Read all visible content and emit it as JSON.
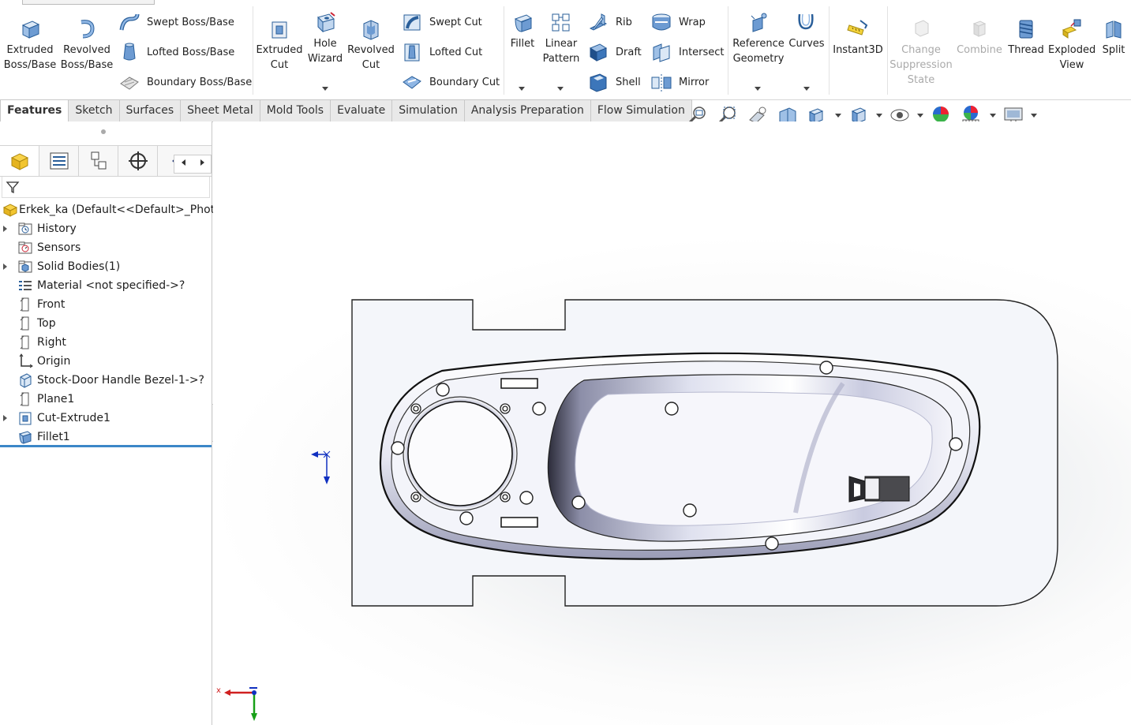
{
  "ribbon": {
    "extruded_boss": "Extruded\nBoss/Base",
    "revolved_boss": "Revolved\nBoss/Base",
    "swept_boss": "Swept Boss/Base",
    "lofted_boss": "Lofted Boss/Base",
    "boundary_boss": "Boundary Boss/Base",
    "extruded_cut": "Extruded\nCut",
    "hole_wizard": "Hole\nWizard",
    "revolved_cut": "Revolved\nCut",
    "swept_cut": "Swept Cut",
    "lofted_cut": "Lofted Cut",
    "boundary_cut": "Boundary Cut",
    "fillet": "Fillet",
    "linear_pattern": "Linear\nPattern",
    "rib": "Rib",
    "draft": "Draft",
    "shell": "Shell",
    "wrap": "Wrap",
    "intersect": "Intersect",
    "mirror": "Mirror",
    "reference_geometry": "Reference\nGeometry",
    "curves": "Curves",
    "instant3d": "Instant3D",
    "change_suppression": "Change\nSuppression\nState",
    "combine": "Combine",
    "thread": "Thread",
    "exploded_view": "Exploded\nView",
    "split": "Split"
  },
  "tabs": [
    {
      "label": "Features",
      "active": true
    },
    {
      "label": "Sketch"
    },
    {
      "label": "Surfaces"
    },
    {
      "label": "Sheet Metal"
    },
    {
      "label": "Mold Tools"
    },
    {
      "label": "Evaluate"
    },
    {
      "label": "Simulation"
    },
    {
      "label": "Analysis Preparation"
    },
    {
      "label": "Flow Simulation"
    }
  ],
  "heads_up_icons": [
    "zoom-to-fit-icon",
    "zoom-to-area-icon",
    "previous-view-icon",
    "section-view-icon",
    "view-orientation-icon",
    "display-style-icon",
    "hide-show-items-icon",
    "edit-appearance-icon",
    "apply-scene-icon",
    "view-settings-icon"
  ],
  "tree": {
    "root": "Erkek_ka  (Default<<Default>_Photo",
    "items": [
      {
        "label": "History",
        "icon": "history-folder-icon",
        "expandable": true
      },
      {
        "label": "Sensors",
        "icon": "sensors-folder-icon",
        "expandable": false
      },
      {
        "label": "Solid Bodies(1)",
        "icon": "solid-bodies-folder-icon",
        "expandable": true
      },
      {
        "label": "Material <not specified->?",
        "icon": "material-icon",
        "expandable": false
      },
      {
        "label": "Front",
        "icon": "plane-icon",
        "expandable": false
      },
      {
        "label": "Top",
        "icon": "plane-icon",
        "expandable": false
      },
      {
        "label": "Right",
        "icon": "plane-icon",
        "expandable": false
      },
      {
        "label": "Origin",
        "icon": "origin-icon",
        "expandable": false
      },
      {
        "label": "Stock-Door Handle Bezel-1->?",
        "icon": "derived-part-icon",
        "expandable": false
      },
      {
        "label": "Plane1",
        "icon": "plane-icon",
        "expandable": false
      },
      {
        "label": "Cut-Extrude1",
        "icon": "cut-extrude-icon",
        "expandable": true
      },
      {
        "label": "Fillet1",
        "icon": "fillet-feature-icon",
        "expandable": false
      }
    ]
  },
  "colors": {
    "accent": "#3c87c8",
    "part_plate": "#f4f6fa",
    "triad_x": "#d02020",
    "triad_y": "#18a018",
    "triad_z": "#1030c0"
  }
}
